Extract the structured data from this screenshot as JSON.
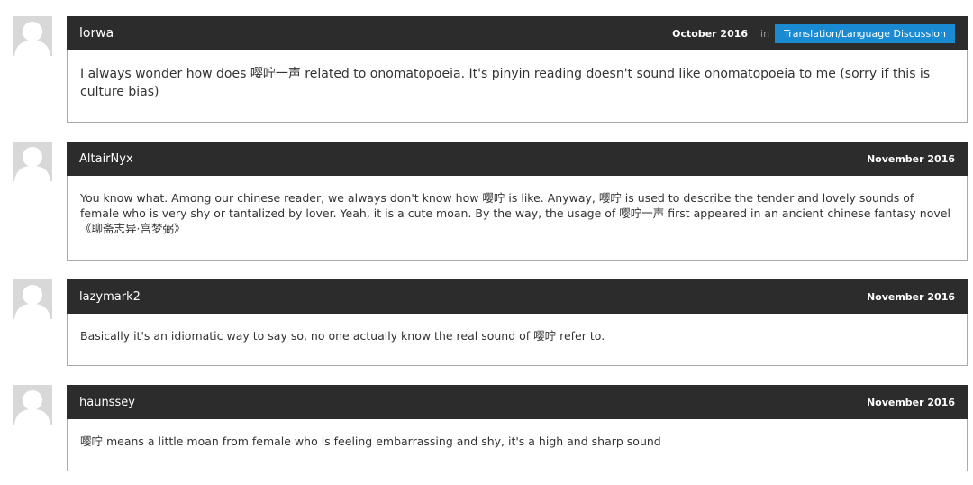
{
  "comments": [
    {
      "author": "lorwa",
      "date": "October 2016",
      "in_label": "in",
      "category": "Translation/Language Discussion",
      "text": "I always wonder how does 嘤咛一声 related to onomatopoeia. It's pinyin reading doesn't sound like onomatopoeia to me (sorry if this is culture bias)"
    },
    {
      "author": "AltairNyx",
      "date": "November 2016",
      "text": "You know what. Among our chinese reader, we always don't know how 嘤咛 is like. Anyway, 嘤咛 is used to describe the tender and lovely sounds of female who is very shy or tantalized by lover. Yeah, it is a cute moan. By the way, the usage of 嘤咛一声 first appeared in an ancient chinese fantasy novel 《聊斋志异·宫梦弼》"
    },
    {
      "author": "lazymark2",
      "date": "November 2016",
      "text": "Basically it's an idiomatic way to say so, no one actually know the real sound of 嘤咛 refer to."
    },
    {
      "author": "haunssey",
      "date": "November 2016",
      "text": "嘤咛 means a little moan from female who is feeling embarrassing and shy, it's a high and sharp sound"
    }
  ]
}
